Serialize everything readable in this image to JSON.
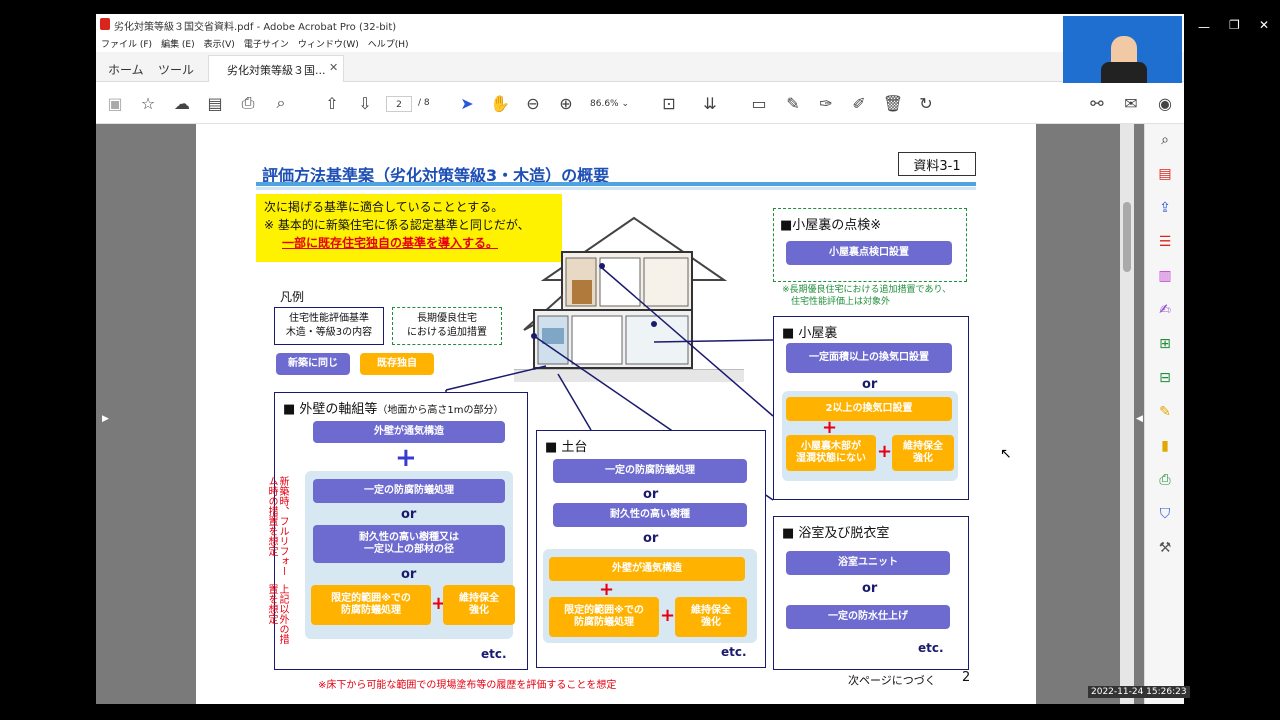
{
  "window": {
    "title": "劣化対策等級３国交省資料.pdf - Adobe Acrobat Pro (32-bit)",
    "timestamp": "2022-11-24 15:26:23"
  },
  "menu": [
    "ファイル (F)",
    "編集 (E)",
    "表示(V)",
    "電子サイン",
    "ウィンドウ(W)",
    "ヘルプ(H)"
  ],
  "tabs": {
    "home": "ホーム",
    "tools": "ツール",
    "doc": "劣化対策等級３国..."
  },
  "toolbar": {
    "page_current": "2",
    "page_total": "/ 8",
    "zoom": "86.6%"
  },
  "slide": {
    "title": "評価方法基準案（劣化対策等級3・木造）の概要",
    "ref": "資料3-1",
    "intro_line1": "次に掲げる基準に適合していることとする。",
    "intro_line2": "※ 基本的に新築住宅に係る認定基準と同じだが、",
    "intro_line3": "一部に既存住宅独自の基準を導入する。",
    "legend_title": "凡例",
    "legend_box1": "住宅性能評価基準\n木造・等級3の内容",
    "legend_box2": "長期優良住宅\nにおける追加措置",
    "legend_same": "新築に同じ",
    "legend_unique": "既存独自",
    "attic_check_title": "■小屋裏の点検※",
    "attic_check_btn": "小屋裏点検口設置",
    "attic_check_note": "※長期優良住宅における追加措置であり、\n　住宅性能評価上は対象外",
    "attic_title": "■ 小屋裏",
    "attic_opt1": "一定面積以上の換気口設置",
    "attic_opt2": "2以上の換気口設置",
    "attic_opt3": "小屋裏木部が\n湿潤状態にない",
    "attic_opt4": "維持保全\n強化",
    "wall_title": "■ 外壁の軸組等",
    "wall_title_sub": "（地面から高さ1mの部分）",
    "wall_opt1": "外壁が通気構造",
    "wall_opt2": "一定の防腐防蟻処理",
    "wall_opt3": "耐久性の高い樹種又は\n一定以上の部材の径",
    "wall_opt4": "限定的範囲※での\n防腐防蟻処理",
    "wall_opt5": "維持保全\n強化",
    "wall_side1": "新築時、フルリフォーム時の措置を想定",
    "wall_side2": "上記以外の措置を想定",
    "base_title": "■ 土台",
    "base_opt1": "一定の防腐防蟻処理",
    "base_opt2": "耐久性の高い樹種",
    "base_opt3": "外壁が通気構造",
    "base_opt4": "限定的範囲※での\n防腐防蟻処理",
    "base_opt5": "維持保全\n強化",
    "bath_title": "■ 浴室及び脱衣室",
    "bath_opt1": "浴室ユニット",
    "bath_opt2": "一定の防水仕上げ",
    "or": "or",
    "etc": "etc.",
    "footnote": "※床下から可能な範囲での現場塗布等の履歴を評価することを想定",
    "next": "次ページにつづく",
    "page_no": "2"
  },
  "colors": {
    "purple": "#6e6bd0",
    "orange": "#ffb300",
    "navy": "#1a1a6e",
    "red": "#e60012",
    "yellow": "#fff200",
    "green": "#1f8f3a"
  }
}
